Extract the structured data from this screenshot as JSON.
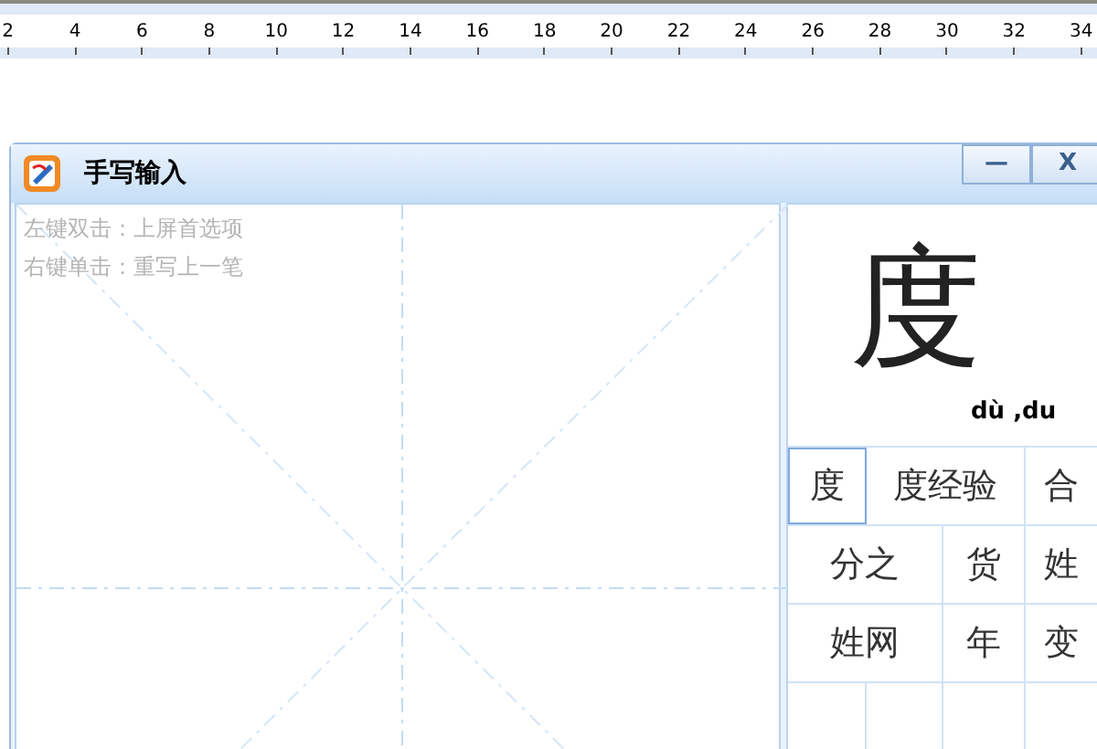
{
  "ruler": {
    "labels": [
      "2",
      "4",
      "6",
      "8",
      "10",
      "12",
      "14",
      "16",
      "18",
      "20",
      "22",
      "24",
      "26",
      "28",
      "30",
      "32",
      "34"
    ]
  },
  "window": {
    "title": "手写输入",
    "buttons": [
      {
        "kind": "minimize",
        "label": "—"
      },
      {
        "kind": "close",
        "label": "X"
      }
    ]
  },
  "writing_pad": {
    "hints": [
      "左键双击：上屏首选项",
      "右键单击：重写上一笔"
    ]
  },
  "preview": {
    "character": "度",
    "pinyin": "dù ,du"
  },
  "candidates": [
    [
      {
        "text": "度",
        "selected": true
      },
      {
        "text": "度经验",
        "selected": false
      },
      {
        "text": "合",
        "selected": false
      }
    ],
    [
      {
        "text": "分之",
        "selected": false
      },
      {
        "text": "货",
        "selected": false
      },
      {
        "text": "姓",
        "selected": false
      }
    ],
    [
      {
        "text": "姓网",
        "selected": false
      },
      {
        "text": "年",
        "selected": false
      },
      {
        "text": "变",
        "selected": false
      }
    ]
  ]
}
